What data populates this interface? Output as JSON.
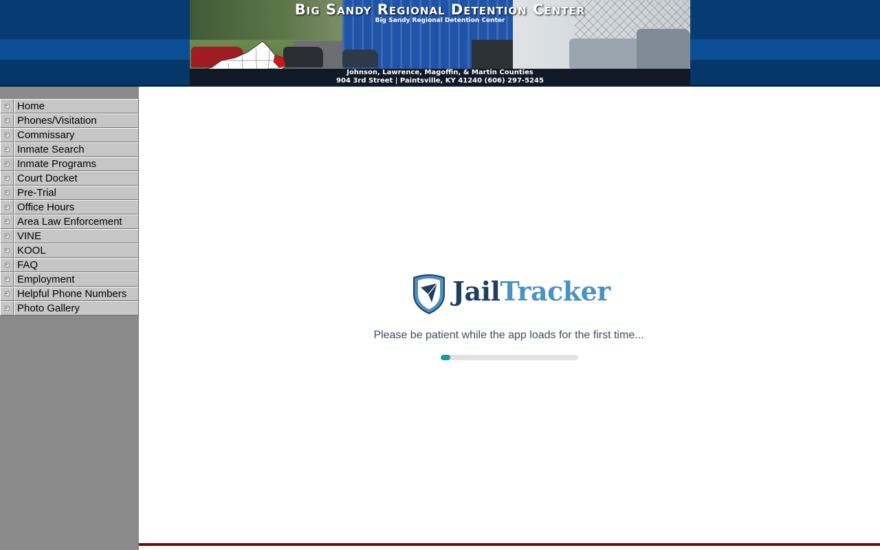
{
  "header": {
    "title": "Big Sandy Regional Detention Center",
    "subtitle": "Big Sandy Regional Detention Center",
    "counties": "Johnson, Lawrence, Magoffin, & Martin Counties",
    "address": "904 3rd Street | Paintsville, KY 41240    (606) 297-5245"
  },
  "sidebar": {
    "items": [
      {
        "label": "Home"
      },
      {
        "label": "Phones/Visitation"
      },
      {
        "label": "Commissary"
      },
      {
        "label": "Inmate Search"
      },
      {
        "label": "Inmate Programs"
      },
      {
        "label": "Court Docket"
      },
      {
        "label": "Pre-Trial"
      },
      {
        "label": "Office Hours"
      },
      {
        "label": " Area Law Enforcement"
      },
      {
        "label": " VINE"
      },
      {
        "label": " KOOL"
      },
      {
        "label": " FAQ"
      },
      {
        "label": " Employment"
      },
      {
        "label": "Helpful Phone Numbers"
      },
      {
        "label": "Photo Gallery"
      }
    ]
  },
  "loader": {
    "brand_part1": "Jail",
    "brand_part2": "Tracker",
    "icon": "paper-plane-shield-icon",
    "message": "Please be patient while the app loads for the first time...",
    "progress_percent": 7
  },
  "colors": {
    "header_bg": "#063b73",
    "sidebar_bg": "#8a8a8a",
    "nav_button": "#c6c6c6",
    "brand_dark": "#1f3e62",
    "brand_light": "#4a92c4",
    "progress": "#1c97a3",
    "footer_rule": "#6e0a0a"
  }
}
